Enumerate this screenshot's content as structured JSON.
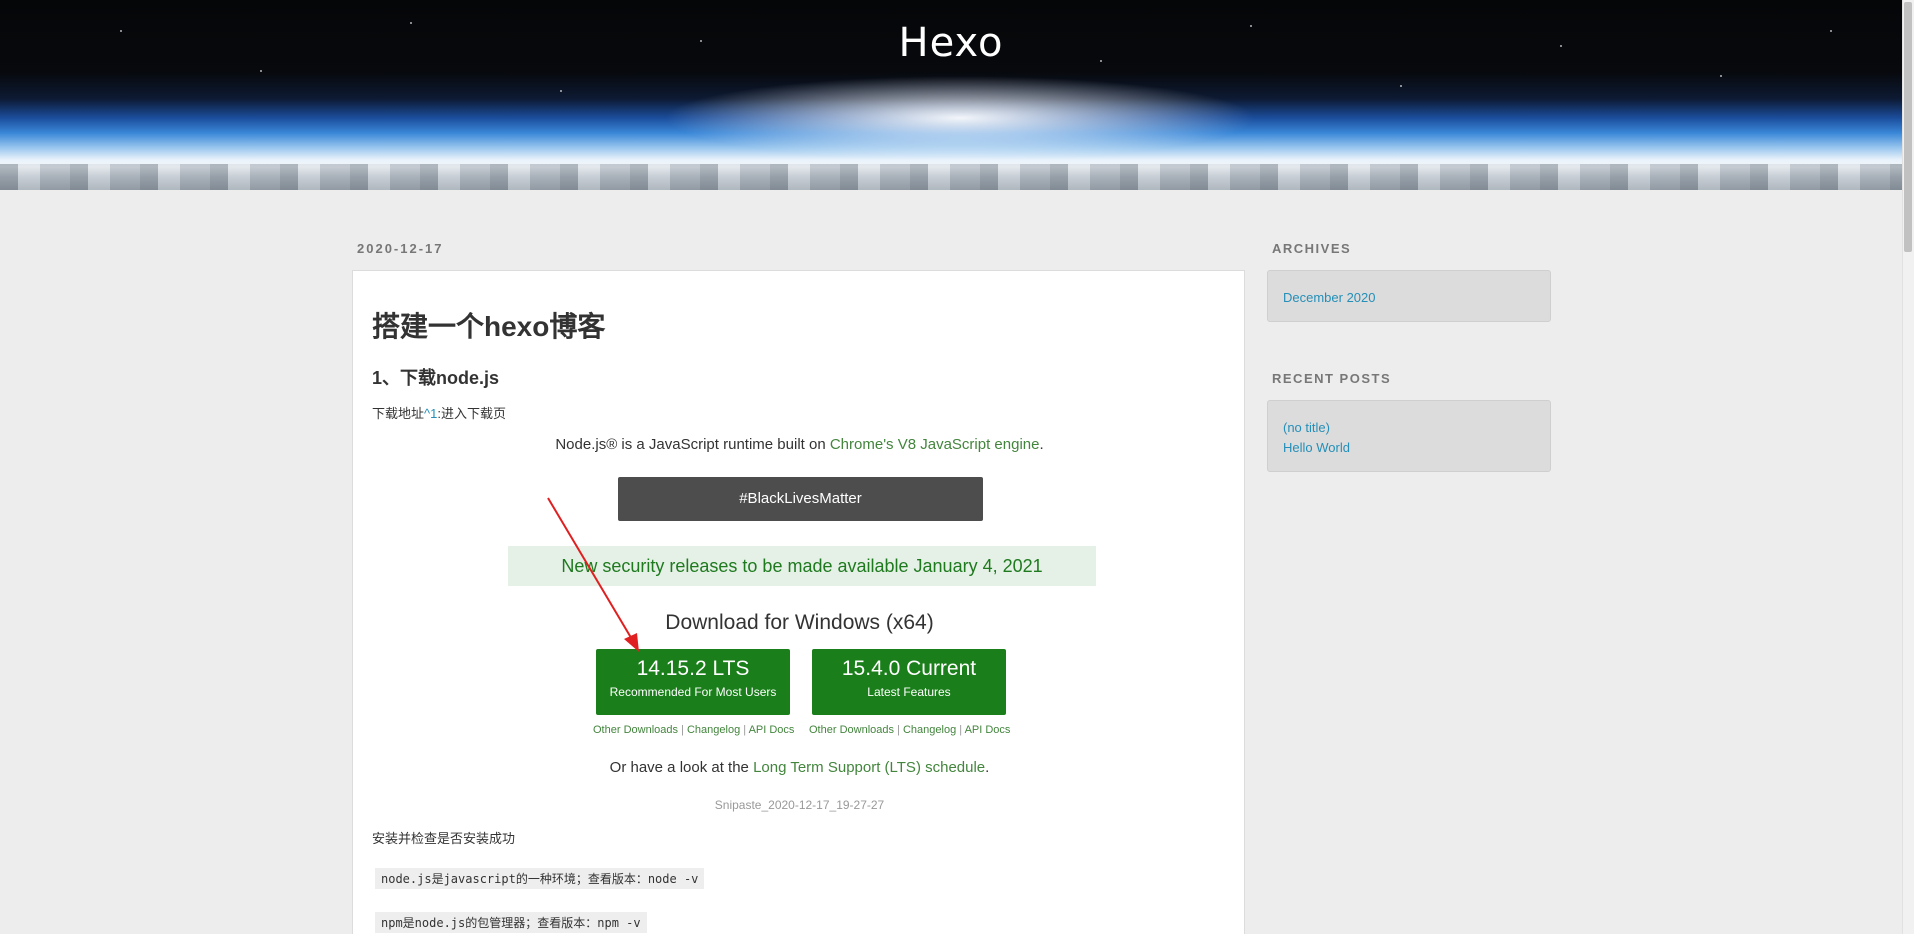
{
  "header": {
    "site_title": "Hexo"
  },
  "post": {
    "date": "2020-12-17",
    "title": "搭建一个hexo博客",
    "section_heading": "1、下载node.js",
    "download_prefix": "下载地址",
    "download_ref": "^1",
    "download_suffix": ":进入下载页",
    "install_check": "安装并检查是否安装成功",
    "code_lines": [
      "node.js是javascript的一种环境；查看版本：node -v",
      "npm是node.js的包管理器；查看版本：npm -v"
    ]
  },
  "embedded_screenshot": {
    "tagline_prefix": "Node.js® is a JavaScript runtime built on ",
    "tagline_link": "Chrome's V8 JavaScript engine",
    "tagline_suffix": ".",
    "blm_button": "#BlackLivesMatter",
    "security_notice": "New security releases to be made available January 4, 2021",
    "download_heading": "Download for Windows (x64)",
    "lts_version": "14.15.2 LTS",
    "lts_subtitle": "Recommended For Most Users",
    "current_version": "15.4.0 Current",
    "current_subtitle": "Latest Features",
    "link_other": "Other Downloads",
    "link_changelog": "Changelog",
    "link_api": "API Docs",
    "lts_line_prefix": "Or have a look at the ",
    "lts_line_link": "Long Term Support (LTS) schedule",
    "lts_line_suffix": ".",
    "caption": "Snipaste_2020-12-17_19-27-27"
  },
  "sidebar": {
    "archives_title": "ARCHIVES",
    "archives": [
      "December 2020"
    ],
    "recent_title": "RECENT POSTS",
    "recent_posts": [
      "(no title)",
      "Hello World"
    ]
  },
  "colors": {
    "link": "#258fb8",
    "node_green": "#1a7f1a",
    "annotation_arrow": "#e02020"
  }
}
